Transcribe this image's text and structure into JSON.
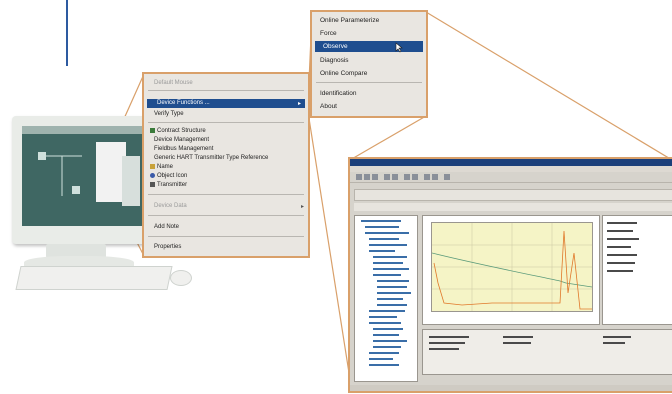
{
  "context_menu": {
    "header": "Default Mouse",
    "items": [
      {
        "label": "Device Functions ...",
        "selected": true,
        "submenu": true
      },
      {
        "label": "Verify Type"
      },
      {
        "label": "Contract Structure",
        "icon": "tree-icon"
      },
      {
        "label": "Device Management"
      },
      {
        "label": "Fieldbus Management"
      },
      {
        "label": "Generic HART Transmitter Type Reference"
      },
      {
        "label": "Name",
        "icon": "name-icon"
      },
      {
        "label": "Object Icon",
        "icon": "object-icon"
      },
      {
        "label": "Transmitter",
        "icon": "transmitter-icon"
      },
      {
        "label": "Device Data",
        "disabled": true,
        "submenu": true
      },
      {
        "label": "Add Note"
      },
      {
        "label": "Properties"
      }
    ]
  },
  "submenu": {
    "items": [
      {
        "label": "Online Parameterize"
      },
      {
        "label": "Force"
      },
      {
        "label": "Observe",
        "selected": true
      },
      {
        "label": "Diagnosis"
      },
      {
        "label": "Online Compare"
      },
      {
        "label": "Identification"
      },
      {
        "label": "About"
      }
    ]
  },
  "colors": {
    "accent_border": "#d9a06a",
    "selection": "#1f4e8f",
    "blue_rule": "#2d5aa0"
  }
}
